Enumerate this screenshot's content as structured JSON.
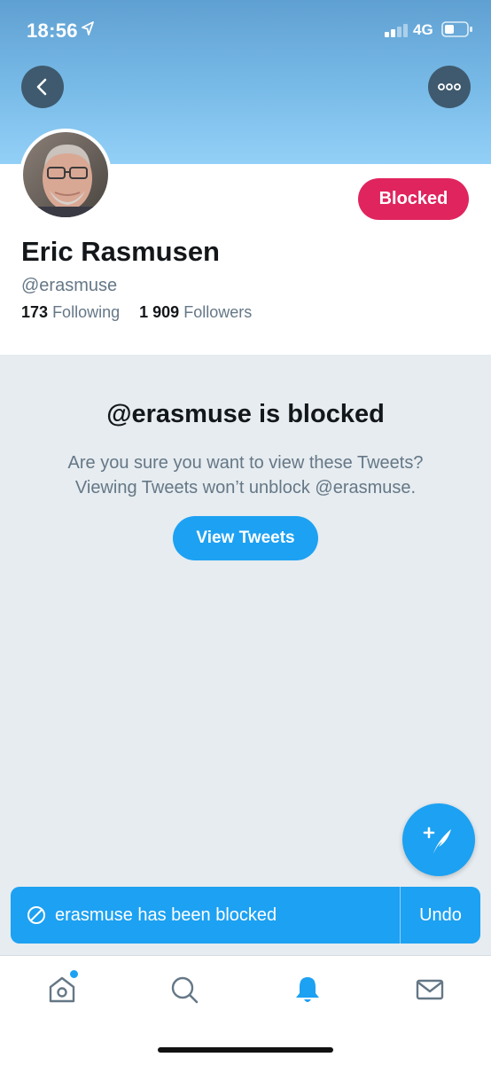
{
  "status_bar": {
    "time": "18:56",
    "network": "4G"
  },
  "profile": {
    "name": "Eric Rasmusen",
    "handle": "@erasmuse",
    "following_count": "173",
    "following_label": "Following",
    "followers_count": "1 909",
    "followers_label": "Followers",
    "blocked_label": "Blocked"
  },
  "blocked_notice": {
    "title": "@erasmuse is blocked",
    "line1": "Are you sure you want to view these Tweets?",
    "line2": "Viewing Tweets won’t unblock @erasmuse.",
    "view_button": "View Tweets"
  },
  "toast": {
    "message": "erasmuse has been blocked",
    "undo_label": "Undo"
  },
  "tabs": [
    "home-icon",
    "search-icon",
    "notifications-icon",
    "messages-icon"
  ],
  "colors": {
    "accent": "#1da1f2",
    "blocked": "#e0245e"
  }
}
